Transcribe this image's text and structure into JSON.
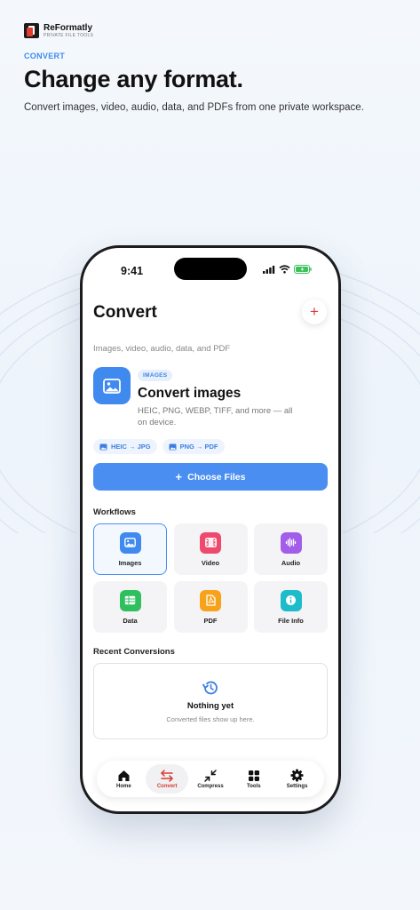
{
  "brand": {
    "name": "ReFormatly",
    "tagline": "PRIVATE FILE TOOLS"
  },
  "hero": {
    "eyebrow": "CONVERT",
    "title": "Change any format.",
    "subtitle": "Convert images, video, audio, data, and PDFs from one private workspace."
  },
  "status_bar": {
    "time": "9:41"
  },
  "screen": {
    "title": "Convert",
    "subtitle": "Images, video, audio, data, and PDF",
    "add_icon": "plus-icon"
  },
  "feature": {
    "badge": "IMAGES",
    "title": "Convert images",
    "description": "HEIC, PNG, WEBP, TIFF, and more — all on device.",
    "chips": [
      "HEIC → JPG",
      "PNG → PDF"
    ],
    "button_label": "Choose Files"
  },
  "workflows": {
    "heading": "Workflows",
    "items": [
      {
        "label": "Images",
        "icon": "image-icon",
        "color": "#3f89ef"
      },
      {
        "label": "Video",
        "icon": "film-icon",
        "color": "#ee4a6d"
      },
      {
        "label": "Audio",
        "icon": "waveform-icon",
        "color": "#a35ee9"
      },
      {
        "label": "Data",
        "icon": "table-icon",
        "color": "#2fbf5f"
      },
      {
        "label": "PDF",
        "icon": "pdf-icon",
        "color": "#f7a21b"
      },
      {
        "label": "File Info",
        "icon": "info-icon",
        "color": "#1dbccb"
      }
    ]
  },
  "recent": {
    "heading": "Recent Conversions",
    "empty_title": "Nothing yet",
    "empty_desc": "Converted files show up here."
  },
  "tabs": [
    {
      "label": "Home",
      "icon": "house-icon"
    },
    {
      "label": "Convert",
      "icon": "swap-arrows-icon"
    },
    {
      "label": "Compress",
      "icon": "compress-arrows-icon"
    },
    {
      "label": "Tools",
      "icon": "grid-icon"
    },
    {
      "label": "Settings",
      "icon": "gear-icon"
    }
  ],
  "colors": {
    "accent": "#4a8ef1",
    "active_tab": "#d63b30"
  }
}
